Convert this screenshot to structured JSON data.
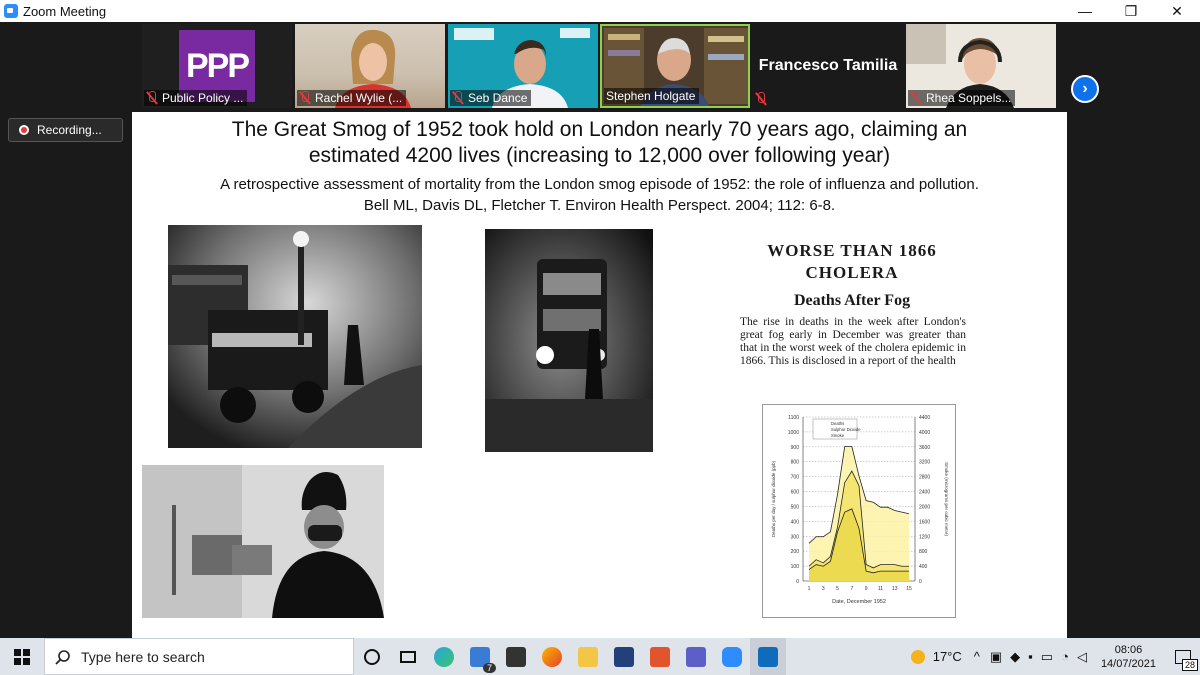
{
  "window": {
    "title": "Zoom Meeting",
    "controls": {
      "minimize": "—",
      "restore": "❐",
      "close": "✕"
    }
  },
  "gallery": {
    "participants": [
      {
        "name": "Public Policy ...",
        "muted": true
      },
      {
        "name": "Rachel Wylie (...",
        "muted": true
      },
      {
        "name": "Seb Dance",
        "muted": true
      },
      {
        "name": "Stephen Holgate",
        "muted": false,
        "active_speaker": true
      },
      {
        "name": "Francesco Tamilia",
        "muted": true,
        "video_off": true
      },
      {
        "name": "Rhea Soppels...",
        "muted": true
      }
    ],
    "ppp_logo_text": "PPP",
    "next_page_icon": "chevron-right-icon"
  },
  "recording": {
    "label": "Recording..."
  },
  "slide": {
    "title_line1": "The Great Smog of 1952 took hold on London nearly 70 years ago, claiming an",
    "title_line2": "estimated 4200 lives (increasing to 12,000 over following year)",
    "subtitle_line1": "A retrospective assessment of mortality from the London smog episode of 1952: the role of influenza and pollution.",
    "subtitle_line2": "Bell ML, Davis DL, Fletcher T. Environ Health Perspect. 2004; 112: 6-8.",
    "clipping": {
      "headline_line1": "WORSE THAN 1866",
      "headline_line2": "CHOLERA",
      "subhead": "Deaths After Fog",
      "body": "The rise in deaths in the week after London's great fog early in December was greater than that in the worst week of the cholera epidemic in 1866. This is disclosed in a report of the health"
    },
    "graph": {
      "legend": [
        "Deaths",
        "Sulphur Dioxide",
        "Smoke"
      ],
      "left_axis_ticks": [
        "0",
        "100",
        "200",
        "300",
        "400",
        "500",
        "600",
        "700",
        "800",
        "900",
        "1000",
        "1100"
      ],
      "right_axis_ticks": [
        "0",
        "400",
        "800",
        "1200",
        "1600",
        "2000",
        "2400",
        "2800",
        "3200",
        "3600",
        "4000",
        "4400"
      ],
      "x_ticks": [
        "1",
        "3",
        "5",
        "7",
        "9",
        "11",
        "13",
        "15"
      ],
      "xlabel": "Date, December 1952",
      "ylabel_left": "Deaths per day / sulphur dioxide (ppb)",
      "ylabel_right": "Smoke (micrograms per cubic metre)"
    }
  },
  "taskbar": {
    "search_placeholder": "Type here to search",
    "mail_badge": "7",
    "weather": "17°C",
    "time": "08:06",
    "date": "14/07/2021",
    "notifications": "28"
  }
}
